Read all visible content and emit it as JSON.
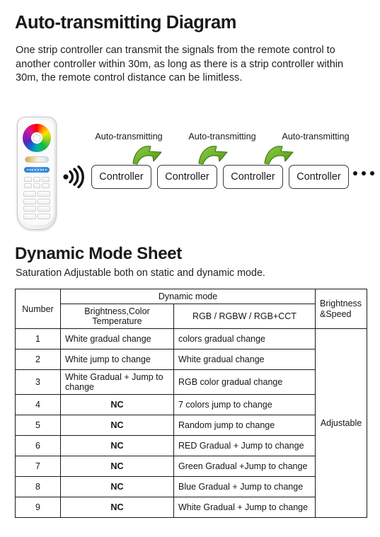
{
  "section1": {
    "title": "Auto-transmitting Diagram",
    "paragraph": "One strip controller can transmit the signals from the remote control to another controller within 30m, as long as there is a strip controller within 30m, the remote control distance can be limitless."
  },
  "diagram": {
    "transmit_labels": [
      "Auto-transmitting",
      "Auto-transmitting",
      "Auto-transmitting"
    ],
    "controllers": [
      "Controller",
      "Controller",
      "Controller",
      "Controller"
    ],
    "ellipsis": "• • •",
    "colors": {
      "arrow_fill": "#6fb52a",
      "arrow_fill_dark": "#4e8c18",
      "arrow_stroke": "#3f7412",
      "signal": "#111111",
      "box_border": "#3a3a3a"
    }
  },
  "section2": {
    "title": "Dynamic Mode Sheet",
    "subtitle": "Saturation Adjustable both on static and dynamic mode."
  },
  "table": {
    "headers": {
      "number": "Number",
      "dynamic_mode": "Dynamic mode",
      "brightness_color_temperature": "Brightness,Color Temperature",
      "rgb": "RGB / RGBW / RGB+CCT",
      "brightness_speed": "Brightness\n&Speed",
      "brightness_speed_line1": "Brightness",
      "brightness_speed_line2": "&Speed"
    },
    "brightness_speed_value": "Adjustable",
    "rows": [
      {
        "number": "1",
        "bct": "White gradual change",
        "rgb": "colors gradual change"
      },
      {
        "number": "2",
        "bct": "White jump to change",
        "rgb": "White gradual change"
      },
      {
        "number": "3",
        "bct": "White Gradual + Jump to change",
        "rgb": "RGB color gradual change"
      },
      {
        "number": "4",
        "bct": "NC",
        "rgb": "7 colors jump to change"
      },
      {
        "number": "5",
        "bct": "NC",
        "rgb": "Random jump to change"
      },
      {
        "number": "6",
        "bct": "NC",
        "rgb": "RED Gradual + Jump to change"
      },
      {
        "number": "7",
        "bct": "NC",
        "rgb": "Green Gradual +Jump to change"
      },
      {
        "number": "8",
        "bct": "NC",
        "rgb": "Blue Gradual + Jump to change"
      },
      {
        "number": "9",
        "bct": "NC",
        "rgb": "White Gradual + Jump to change"
      }
    ]
  }
}
